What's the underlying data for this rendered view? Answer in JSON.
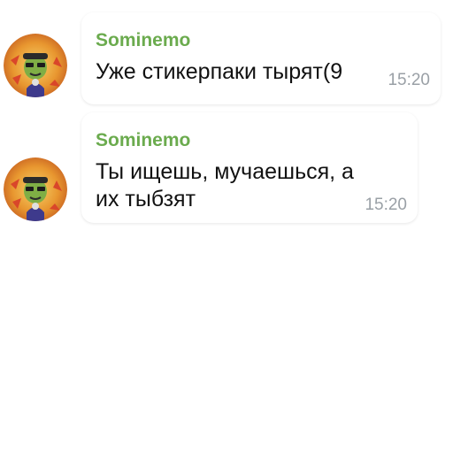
{
  "colors": {
    "sender_name": "#6bab4e",
    "time": "#9aa0a6",
    "bubble": "#ffffff"
  },
  "messages": [
    {
      "sender": "Sominemo",
      "text": "Уже стикерпаки тырят(9",
      "time": "15:20",
      "avatar_icon": "cartoon-character-avatar"
    },
    {
      "sender": "Sominemo",
      "text": "Ты ищешь, мучаешься, а их тыбзят",
      "time": "15:20",
      "avatar_icon": "cartoon-character-avatar"
    }
  ]
}
